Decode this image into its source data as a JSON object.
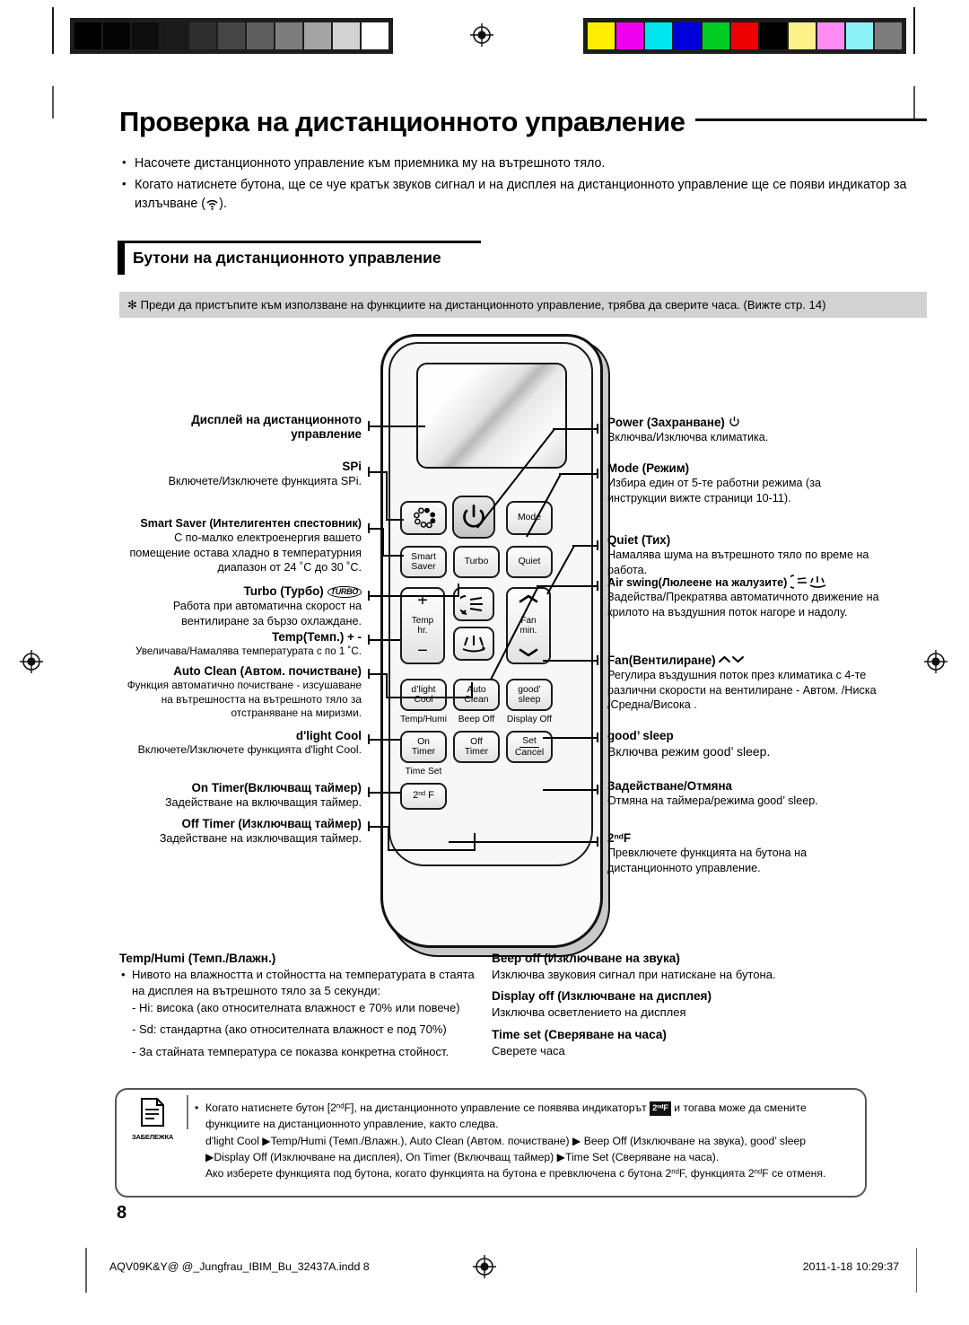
{
  "page": {
    "title": "Проверка на дистанционното управление",
    "number": "8"
  },
  "intro_bullets": [
    "Насочете дистанционното управление към приемника му на вътрешното тяло.",
    "Когато натиснете бутона, ще се чуе кратък звуков сигнал и на дисплея на дистанционното управление ще се появи индикатор за излъчване (",
    ")."
  ],
  "section": {
    "heading": "Бутони на дистанционното управление",
    "note_strip": "✻ Преди да пристъпите към използване на функциите на дистанционното управление, трябва да сверите часа. (Вижте стр. 14)"
  },
  "remote": {
    "buttons": {
      "spi": "",
      "power": "",
      "mode": "Mode",
      "smart_saver_line1": "Smart",
      "smart_saver_line2": "Saver",
      "turbo": "Turbo",
      "quiet": "Quiet",
      "temp_plus": "+",
      "temp_label1": "Temp",
      "temp_label2": "hr.",
      "temp_minus": "−",
      "fan_up": "⌃",
      "fan_label1": "Fan",
      "fan_label2": "min.",
      "fan_down": "⌄",
      "dlight_line1": "d’light",
      "dlight_line2": "Cool",
      "autoclean_line1": "Auto",
      "autoclean_line2": "Clean",
      "goodsleep_line1": "good’",
      "goodsleep_line2": "sleep",
      "ontimer_line1": "On",
      "ontimer_line2": "Timer",
      "offtimer_line1": "Off",
      "offtimer_line2": "Timer",
      "set": "Set",
      "cancel": "Cancel",
      "secondf": "2"
    },
    "sublabels": {
      "temp_humi": "Temp/Humi",
      "beep_off": "Beep Off",
      "display_off": "Display Off",
      "time_set": "Time Set"
    }
  },
  "callouts_left": [
    {
      "title_line1": "Дисплей на дистанционното",
      "title_line2": "управление",
      "body": ""
    },
    {
      "title_line1": "SPi",
      "body": "Включете/Изключете функцията SPi."
    },
    {
      "title_line1": "Smart Saver (Интелигентен спестовник)",
      "body": "С по-малко електроенергия вашето помещение остава хладно в температурния диапазон от 24 ˚С до 30 ˚С."
    },
    {
      "title_line1": "Turbo (Турбо)",
      "body": "Работа при автоматична скорост на вентилиране за бързо охлаждане."
    },
    {
      "title_line1": "Temp(Темп.) + -",
      "body": "Увеличава/Намалява температурата с по 1 ˚С."
    },
    {
      "title_line1": "Auto Clean (Автом. почистване)",
      "body": "Функция автоматично почистване - изсушаване на вътрешността на вътрешното тяло за отстраняване на миризми."
    },
    {
      "title_line1": "d'light Cool",
      "body": "Включете/Изключете функцията d'light Cool."
    },
    {
      "title_line1": "On Timer(Включващ таймер)",
      "body": "Задействане на включващия таймер."
    },
    {
      "title_line1": "Off Timer (Изключващ таймер)",
      "body": "Задействане на изключващия таймер."
    }
  ],
  "callouts_right": [
    {
      "title": "Power (Захранване)",
      "body": "Включва/Изключва климатика."
    },
    {
      "title": "Mode (Режим)",
      "body": "Избира един от 5-те работни режима (за инструкции вижте страници 10-11)."
    },
    {
      "title": "Quiet (Тих)",
      "body": "Намалява шума на вътрешното тяло по време на работа."
    },
    {
      "title": "Air swing(Люлеене на жалузите)",
      "body": "Задейства/Прекратява автоматичното движение на крилото на въздушния поток нагоре и надолу."
    },
    {
      "title": "Fan(Вентилиране)",
      "body": "Регулира въздушния поток през климатика с 4-те различни скорости на вентилиране - Автом. /Ниска /Средна/Висока ."
    },
    {
      "title": "good’ sleep",
      "body": "Включва режим good’ sleep."
    },
    {
      "title": "Задействане/Отмяна",
      "body": "Отмяна на таймера/режима good’ sleep."
    },
    {
      "title": "2ndF",
      "body": "Превключете функцията на бутона на дистанционното управление."
    }
  ],
  "bottom_left": {
    "title": "Temp/Humi (Темп./Влажн.)",
    "bullet": "Нивото на влажността и стойността на температурата в стаята на дисплея на вътрешното тяло за 5 секунди:",
    "dash1": "- Hi: висока (ако относителната влажност е 70% или повече)",
    "dash2": "- Sd: стандартна (ако относителната влажност е под 70%)",
    "dash3": "- За стайната температура се показва конкретна стойност."
  },
  "bottom_right": [
    {
      "title": "Beep off (Изключване на звука)",
      "body": "Изключва звуковия сигнал при натискане на бутона."
    },
    {
      "title": "Display off (Изключване на дисплея)",
      "body": "Изключва осветлението на дисплея"
    },
    {
      "title": "Time set (Сверяване на часа)",
      "body": "Сверете часа"
    }
  ],
  "notebox": {
    "label": "ЗАБЕЛЕЖКА",
    "line1_a": "Когато натиснете бутон [2",
    "line1_b": "F], на дистанционното управление се появява индикаторът",
    "badge": "2",
    "line1_c": "и тогава може да смените",
    "line2": "функциите на дистанционното управление, както следва.",
    "line3": "d'light Cool ▶Temp/Humi (Темп./Влажн.), Auto Clean (Автом. почистване) ▶ Beep Off (Изключване на звука), good’ sleep",
    "line4": "▶Display Off (Изключване на дисплея), On Timer (Включващ таймер) ▶Time Set (Сверяване на часа).",
    "line5_a": "Ако изберете функцията под бутона, когато функцията на бутона е превключена с бутона 2",
    "line5_b": "F, функцията 2",
    "line5_c": "F се отменя."
  },
  "footer": {
    "left": "AQV09K&Y@ @_Jungfrau_IBIM_Bu_32437A.indd   8",
    "right": "2011-1-18   10:29:37"
  },
  "calibration": {
    "grayscale": [
      "#000000",
      "#050505",
      "#0d0d0d",
      "#1a1a1a",
      "#2e2e2e",
      "#454545",
      "#5e5e5e",
      "#7d7d7d",
      "#a3a3a3",
      "#d2d2d2",
      "#ffffff"
    ],
    "colors": [
      "#ffee00",
      "#ee00ee",
      "#00e5ee",
      "#0000dd",
      "#00cc22",
      "#ee0000",
      "#000000",
      "#fdf18a",
      "#ff8cf0",
      "#8cf2f7",
      "#7d7d7d"
    ]
  }
}
